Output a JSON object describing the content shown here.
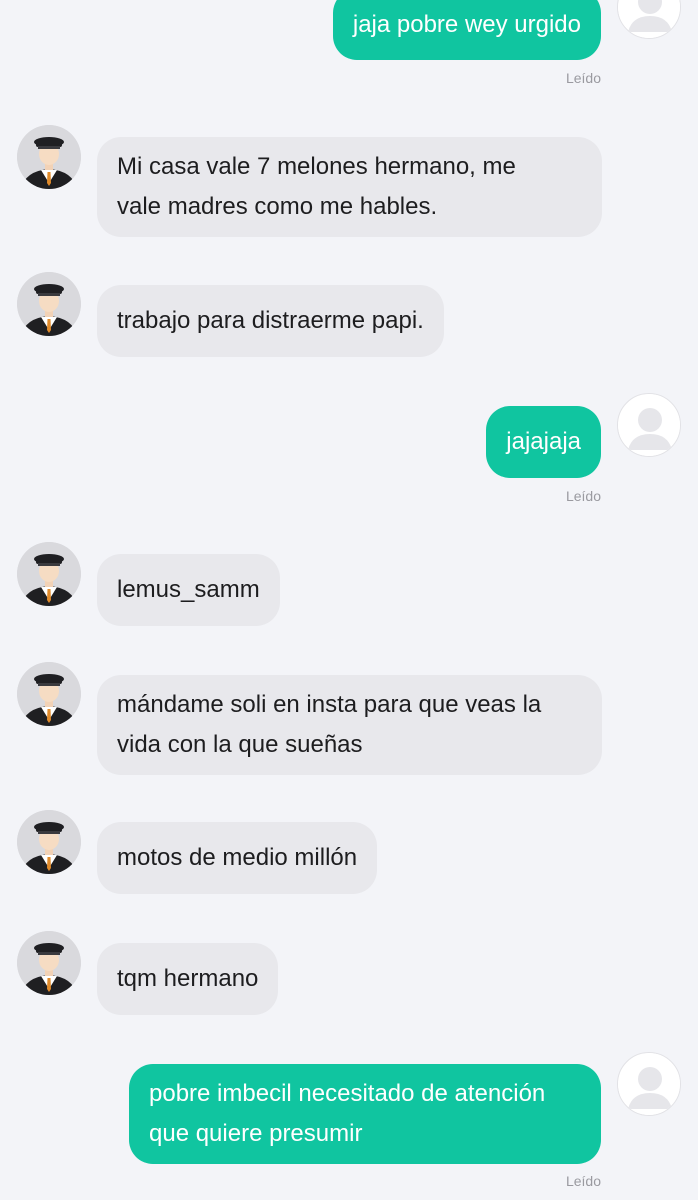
{
  "messages": [
    {
      "from": "me",
      "text": "jaja pobre wey urgido",
      "status": "Leído"
    },
    {
      "from": "them",
      "text": "Mi casa vale 7 melones hermano, me\nvale madres como me hables."
    },
    {
      "from": "them",
      "text": "trabajo para distraerme papi."
    },
    {
      "from": "me",
      "text": "jajajaja",
      "status": "Leído"
    },
    {
      "from": "them",
      "text": "lemus_samm"
    },
    {
      "from": "them",
      "text": "mándame soli en insta para que veas la\nvida con la que sueñas"
    },
    {
      "from": "them",
      "text": "motos de medio millón"
    },
    {
      "from": "them",
      "text": "tqm hermano"
    },
    {
      "from": "me",
      "text": "pobre imbecil necesitado de atención\nque quiere presumir",
      "status": "Leído"
    }
  ],
  "icons": {
    "contact_avatar": "chauffeur-avatar-icon",
    "user_avatar": "default-user-avatar-icon"
  },
  "colors": {
    "outgoing_bubble": "#10c5a0",
    "incoming_bubble": "#e8e8ec",
    "background": "#f3f4f8",
    "read_status": "#9a9aa0"
  }
}
